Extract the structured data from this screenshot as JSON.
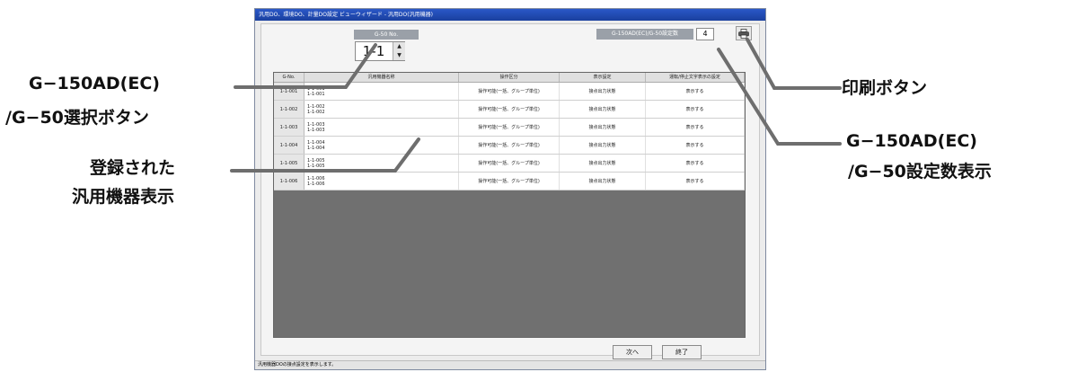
{
  "window": {
    "title": "汎用DO、環境DO、計量DO設定 ビューウィザード - 汎用DO(汎用機器)",
    "status": "汎用機器DOの接点設定を表示します。"
  },
  "g50": {
    "label": "G-50 No.",
    "value": "1-1",
    "count_label": "G-150AD(EC)/G-50設定数",
    "count_value": "4"
  },
  "table": {
    "columns": [
      "G-No.",
      "汎用機器名称",
      "操作区分",
      "表示設定",
      "運転/停止文字表示の設定"
    ],
    "rows": [
      {
        "gno": "1-1-001",
        "name1": "1-1-001",
        "name2": "1-1-001",
        "op": "操作可能(一括、グループ単位)",
        "disp": "接点出力状態",
        "txt": "表示する"
      },
      {
        "gno": "1-1-002",
        "name1": "1-1-002",
        "name2": "1-1-002",
        "op": "操作可能(一括、グループ単位)",
        "disp": "接点出力状態",
        "txt": "表示する"
      },
      {
        "gno": "1-1-003",
        "name1": "1-1-003",
        "name2": "1-1-003",
        "op": "操作可能(一括、グループ単位)",
        "disp": "接点出力状態",
        "txt": "表示する"
      },
      {
        "gno": "1-1-004",
        "name1": "1-1-004",
        "name2": "1-1-004",
        "op": "操作可能(一括、グループ単位)",
        "disp": "接点出力状態",
        "txt": "表示する"
      },
      {
        "gno": "1-1-005",
        "name1": "1-1-005",
        "name2": "1-1-005",
        "op": "操作可能(一括、グループ単位)",
        "disp": "接点出力状態",
        "txt": "表示する"
      },
      {
        "gno": "1-1-006",
        "name1": "1-1-006",
        "name2": "1-1-006",
        "op": "操作可能(一括、グループ単位)",
        "disp": "接点出力状態",
        "txt": "表示する"
      }
    ]
  },
  "buttons": {
    "next": "次へ",
    "end": "終了"
  },
  "annotations": {
    "select_line1": "G−150AD(EC)",
    "select_line2": "/G−50選択ボタン",
    "registered_line1": "登録された",
    "registered_line2": "汎用機器表示",
    "print": "印刷ボタン",
    "count_line1": "G−150AD(EC)",
    "count_line2": "/G−50設定数表示"
  },
  "icons": {
    "print": "printer-icon",
    "spin_up": "triangle-up-icon",
    "spin_down": "triangle-down-icon"
  }
}
